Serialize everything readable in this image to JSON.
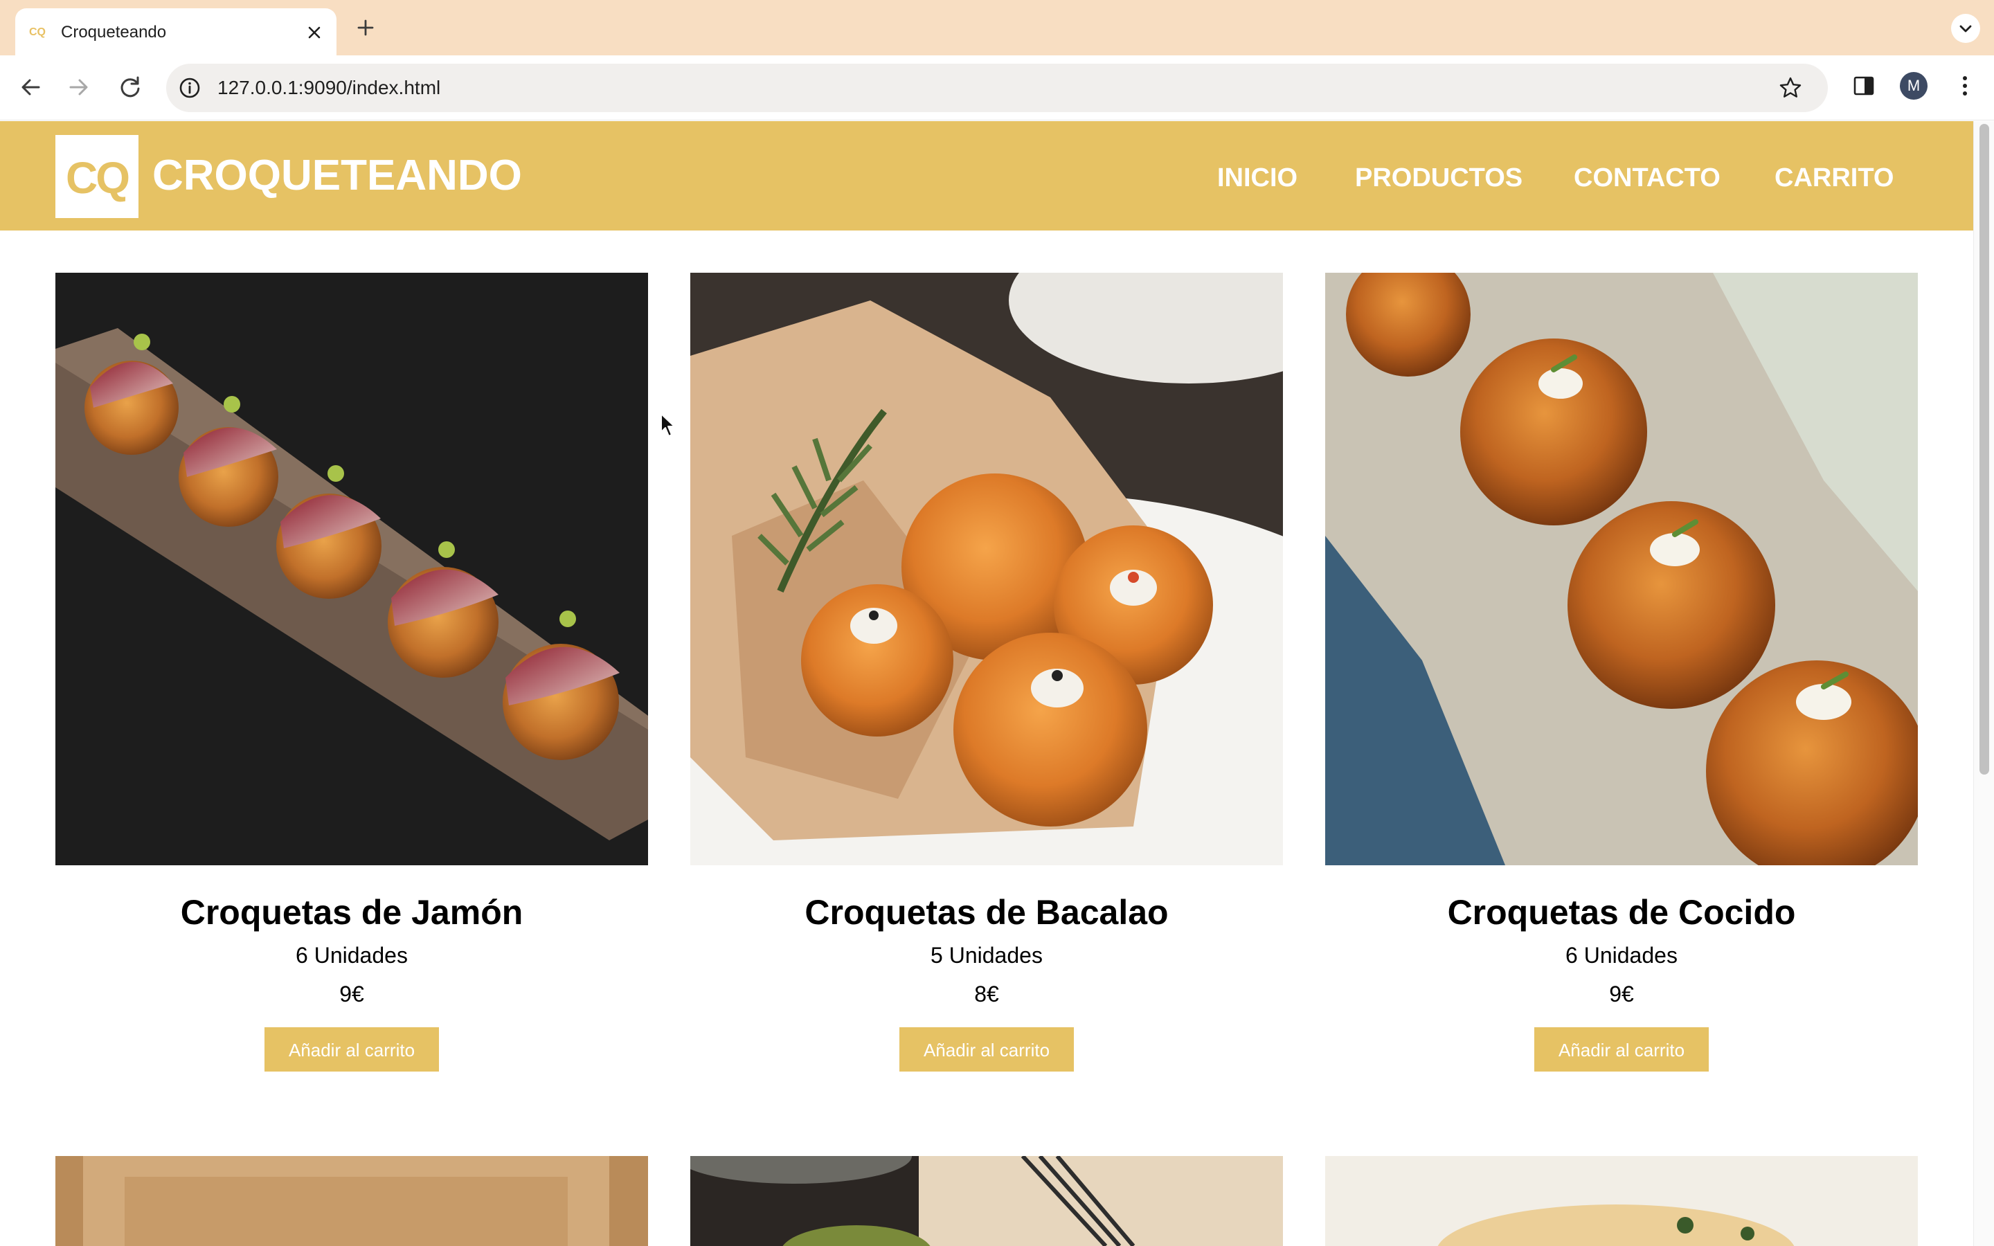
{
  "browser": {
    "tab_title": "Croqueteando",
    "favicon_text": "CQ",
    "url": "127.0.0.1:9090/index.html",
    "profile_initial": "M",
    "icons": [
      "close-icon",
      "plus-icon",
      "chevron-down-icon",
      "back-arrow-icon",
      "forward-arrow-icon",
      "reload-icon",
      "info-icon",
      "star-icon",
      "side-panel-icon",
      "kebab-menu-icon"
    ]
  },
  "site": {
    "logo_text": "CQ",
    "brand": "CROQUETEANDO",
    "nav": [
      "INICIO",
      "PRODUCTOS",
      "CONTACTO",
      "CARRITO"
    ],
    "accent_color": "#e6c264"
  },
  "products": [
    {
      "name": "Croquetas de Jamón",
      "units": "6 Unidades",
      "price": "9€",
      "button": "Añadir al carrito",
      "image": "ham croquettes on a long brown plate"
    },
    {
      "name": "Croquetas de Bacalao",
      "units": "5 Unidades",
      "price": "8€",
      "button": "Añadir al carrito",
      "image": "cod croquettes on paper in a white bowl"
    },
    {
      "name": "Croquetas de Cocido",
      "units": "6 Unidades",
      "price": "9€",
      "button": "Añadir al carrito",
      "image": "cocido croquettes on a speckled ceramic plate"
    }
  ]
}
